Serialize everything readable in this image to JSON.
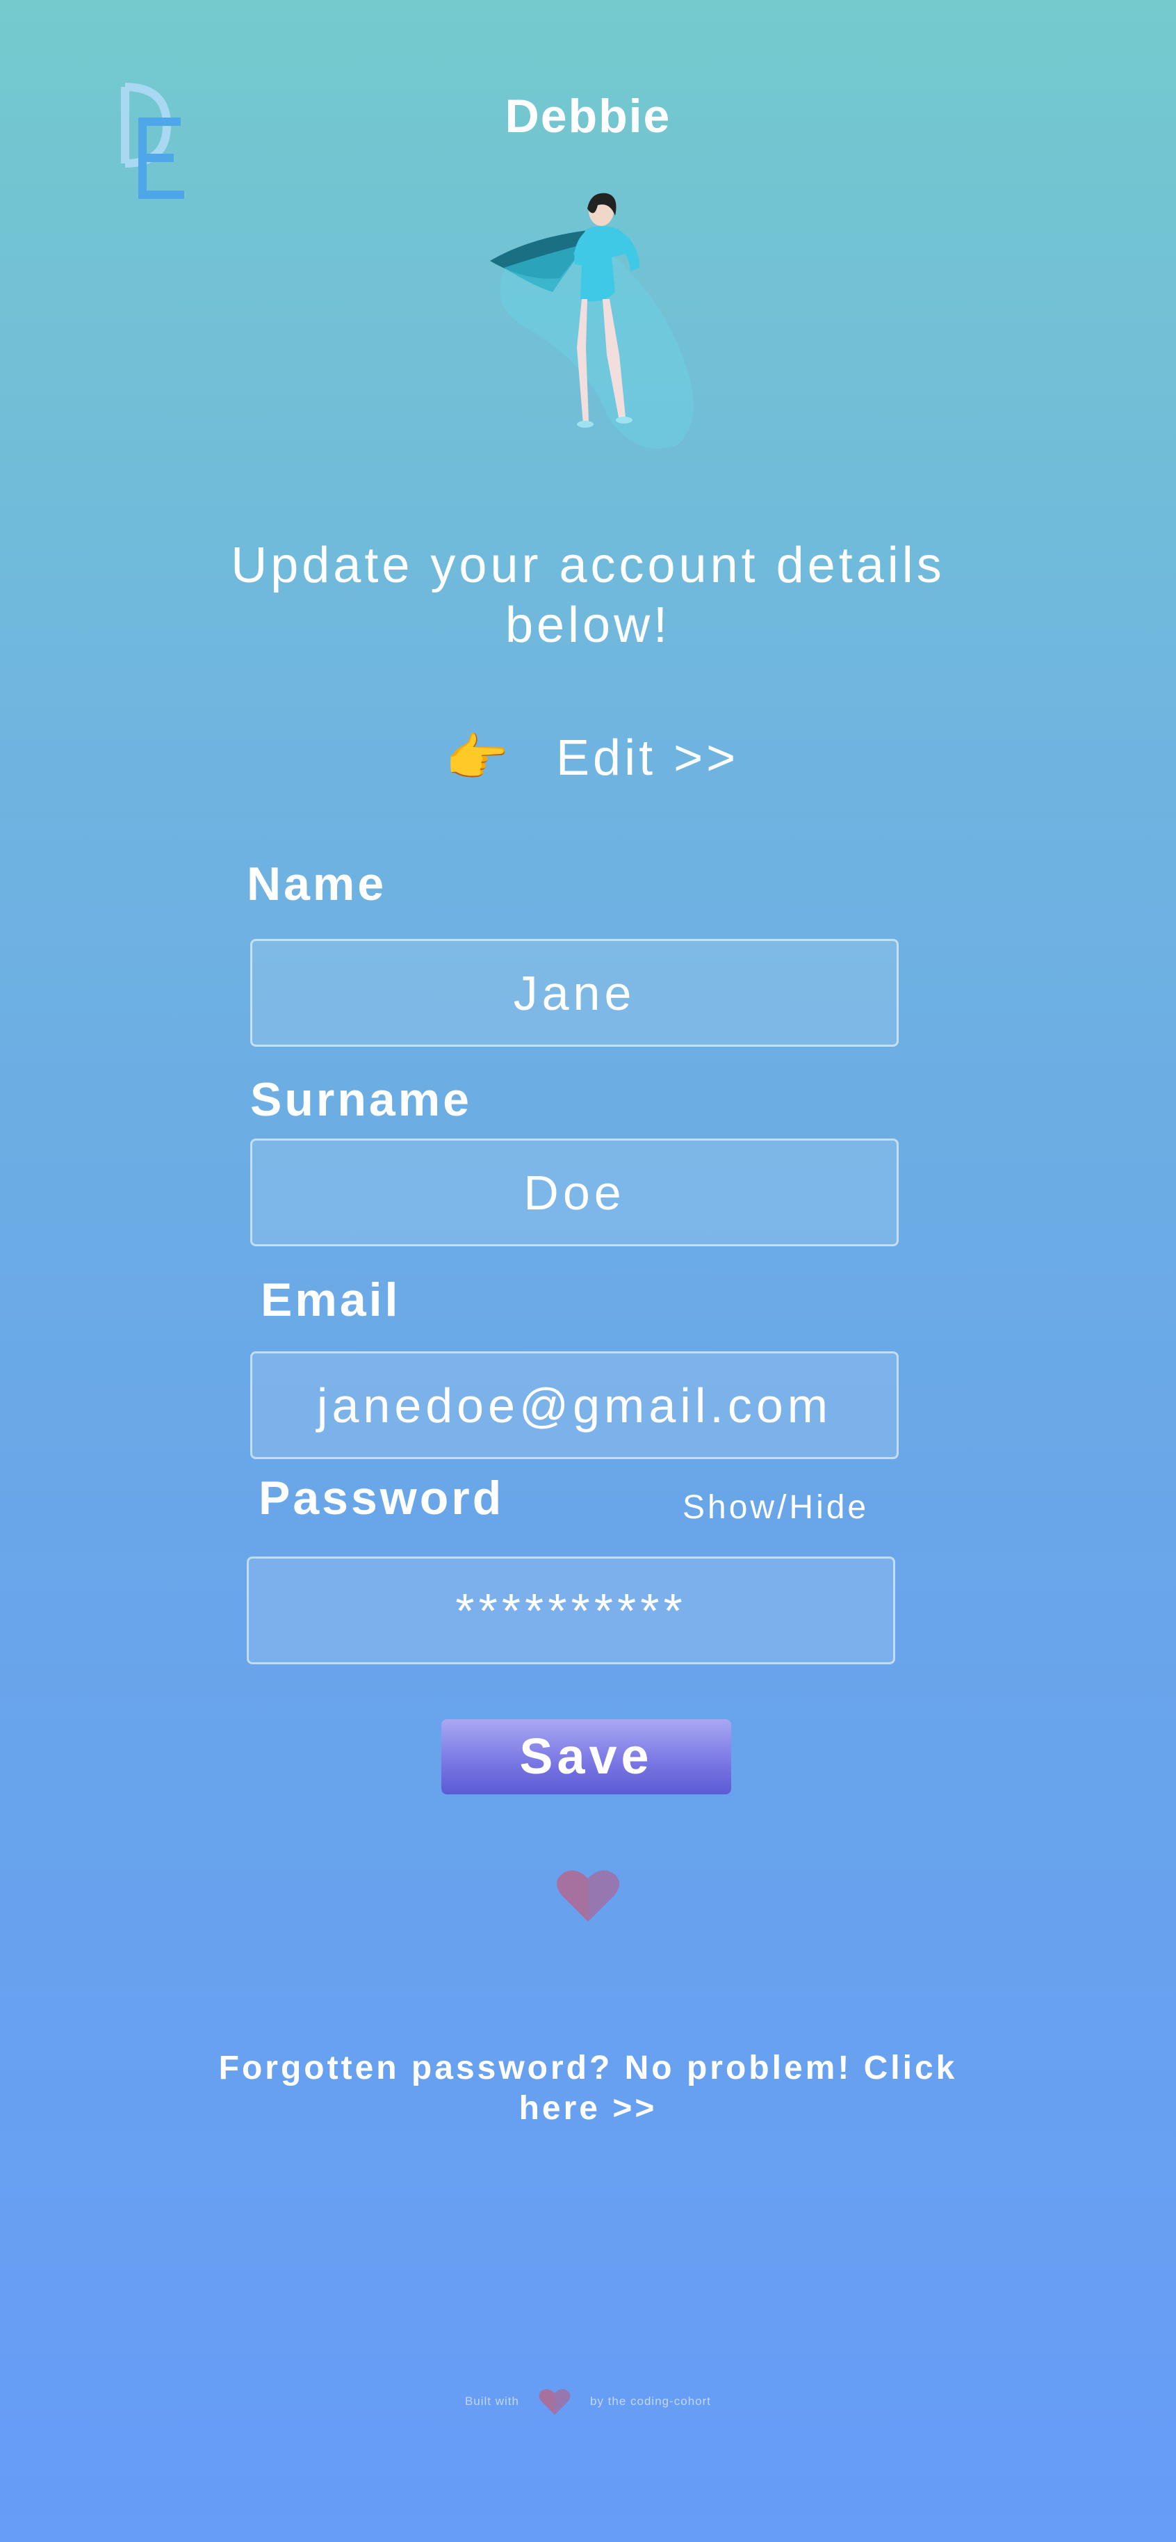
{
  "app": {
    "logo_letters": "DE",
    "username": "Debbie"
  },
  "hero": {
    "illustration": "superhero-woman"
  },
  "heading": "Update your account details below!",
  "edit": {
    "icon": "pointing-hand-icon",
    "icon_glyph": "👉",
    "label": "Edit >>"
  },
  "form": {
    "name": {
      "label": "Name",
      "value": "Jane"
    },
    "surname": {
      "label": "Surname",
      "value": "Doe"
    },
    "email": {
      "label": "Email",
      "value": "janedoe@gmail.com"
    },
    "password": {
      "label": "Password",
      "value": "**********",
      "toggle_label": "Show/Hide"
    },
    "save_label": "Save"
  },
  "decorations": {
    "heart_icon": "heart-icon"
  },
  "forgot_password": "Forgotten password? No problem! Click here >>",
  "footer": {
    "built_with": "Built with",
    "by": "by the coding-cohort"
  },
  "colors": {
    "bg_top": "#74cacd",
    "bg_bottom": "#679cf7",
    "heart": "#a7719f",
    "save_button": "#6f6de0"
  }
}
